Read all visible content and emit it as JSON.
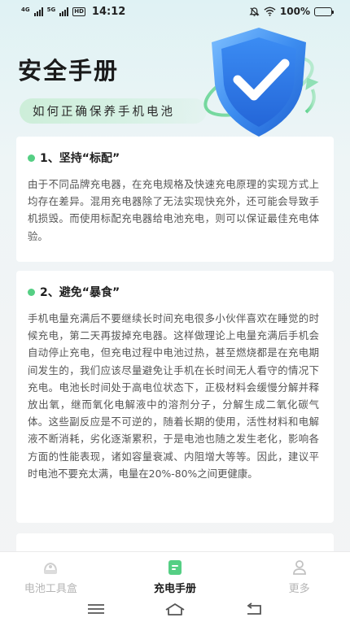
{
  "status_bar": {
    "net_left": "4G",
    "net_right": "5G",
    "hd": "HD",
    "time": "14:12",
    "battery": "100%"
  },
  "header": {
    "title": "安全手册",
    "subtitle": "如何正确保养手机电池"
  },
  "sections": [
    {
      "title": "1、坚持“标配”",
      "body": "由于不同品牌充电器，在充电规格及快速充电原理的实现方式上均存在差异。混用充电器除了无法实现快充外，还可能会导致手机损毁。而使用标配充电器给电池充电，则可以保证最佳充电体验。"
    },
    {
      "title": "2、避免“暴食”",
      "body": "手机电量充满后不要继续长时间充电很多小伙伴喜欢在睡觉的时候充电，第二天再拔掉充电器。这样做理论上电量充满后手机会自动停止充电，但充电过程中电池过热，甚至燃烧都是在充电期间发生的，我们应该尽量避免让手机在长时间无人看守的情况下充电。电池长时间处于高电位状态下，正极材料会缓慢分解并释放出氧，继而氧化电解液中的溶剂分子，分解生成二氧化碳气体。这些副反应是不可逆的，随着长期的使用，活性材料和电解液不断消耗，劣化逐渐累积，于是电池也随之发生老化，影响各方面的性能表现，诸如容量衰减、内阻增大等等。因此，建议平时电池不要充太满，电量在20%-80%之间更健康。"
    }
  ],
  "bottom_nav": [
    {
      "label": "电池工具盒",
      "icon": "toolbox-icon",
      "active": false
    },
    {
      "label": "充电手册",
      "icon": "manual-icon",
      "active": true
    },
    {
      "label": "更多",
      "icon": "user-icon",
      "active": false
    }
  ],
  "colors": {
    "accent": "#55cf84",
    "shield": "#2f7fe6"
  }
}
